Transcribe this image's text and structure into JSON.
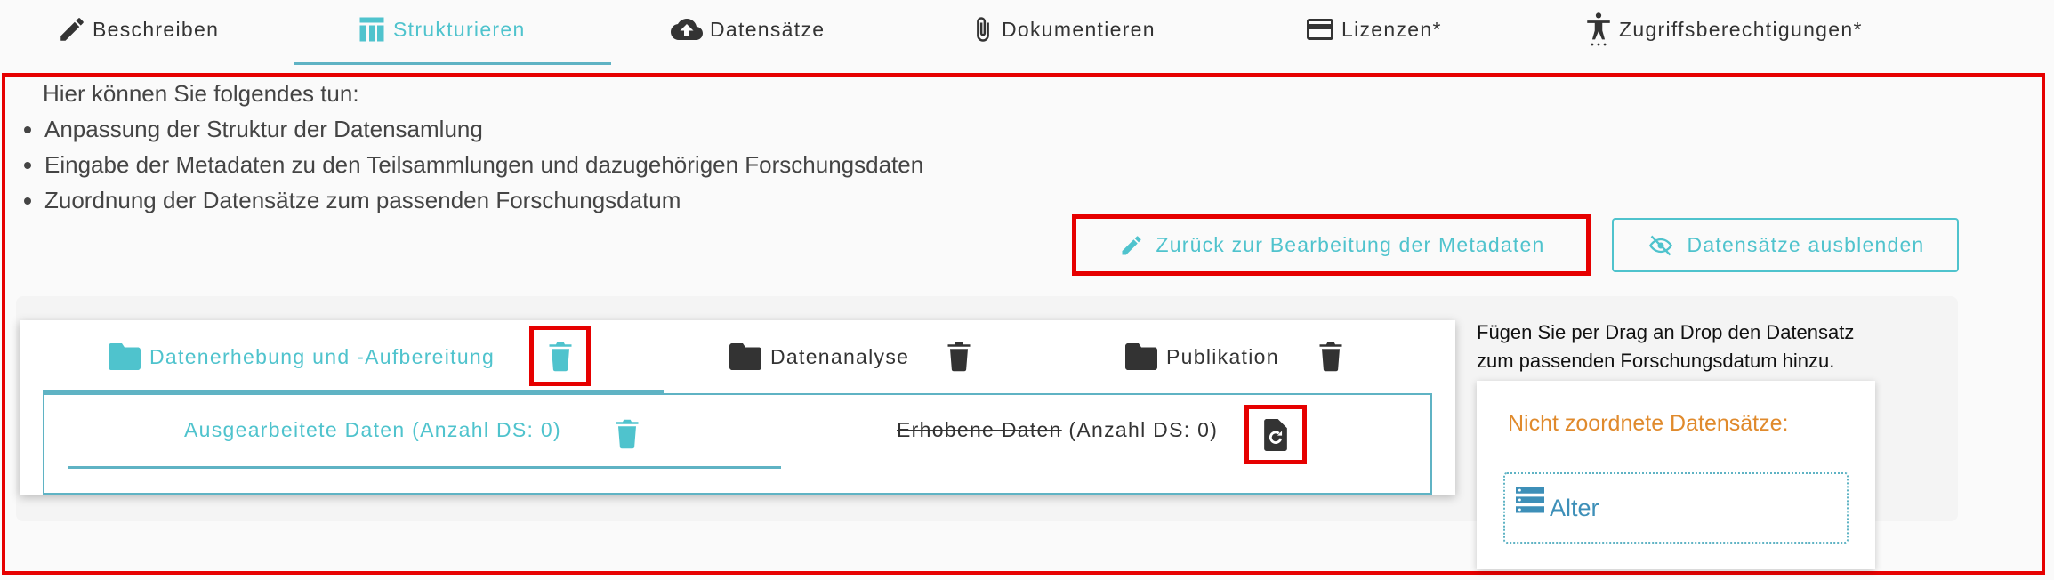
{
  "top_tabs": [
    {
      "label": "Beschreiben",
      "icon": "pencil-icon",
      "active": false
    },
    {
      "label": "Strukturieren",
      "icon": "table-icon",
      "active": true
    },
    {
      "label": "Datensätze",
      "icon": "cloud-upload-icon",
      "active": false
    },
    {
      "label": "Dokumentieren",
      "icon": "paperclip-icon",
      "active": false
    },
    {
      "label": "Lizenzen*",
      "icon": "credit-card-icon",
      "active": false
    },
    {
      "label": "Zugriffsberechtigungen*",
      "icon": "accessibility-icon",
      "active": false
    }
  ],
  "intro": {
    "text": "Hier können Sie folgendes tun:",
    "items": [
      "Anpassung der Struktur der Datensamlung",
      "Eingabe der Metadaten zu den Teilsammlungen und dazugehörigen Forschungsdaten",
      "Zuordnung der Datensätze zum passenden Forschungsdatum"
    ]
  },
  "actions": {
    "back_label": "Zurück zur Bearbeitung der Metadaten",
    "hide_label": "Datensätze ausblenden"
  },
  "folders": [
    {
      "label": "Datenerhebung und -Aufbereitung",
      "active": true
    },
    {
      "label": "Datenanalyse",
      "active": false
    },
    {
      "label": "Publikation",
      "active": false
    }
  ],
  "subtabs": {
    "first_label": "Ausgearbeitete Daten (Anzahl DS: 0)",
    "second_strike": "Erhobene Daten",
    "second_rest": " (Anzahl DS: 0)"
  },
  "side": {
    "hint_line1": "Fügen Sie per Drag an Drop den Datensatz",
    "hint_line2": "zum passenden Forschungsdatum hinzu.",
    "unassigned_title": "Nicht zoordnete Datensätze:",
    "dataset_label": "Alter"
  },
  "colors": {
    "accent": "#4fc3cd",
    "highlight_red": "#e60000",
    "orange": "#e08a2c",
    "link_blue": "#3d8fb8"
  }
}
